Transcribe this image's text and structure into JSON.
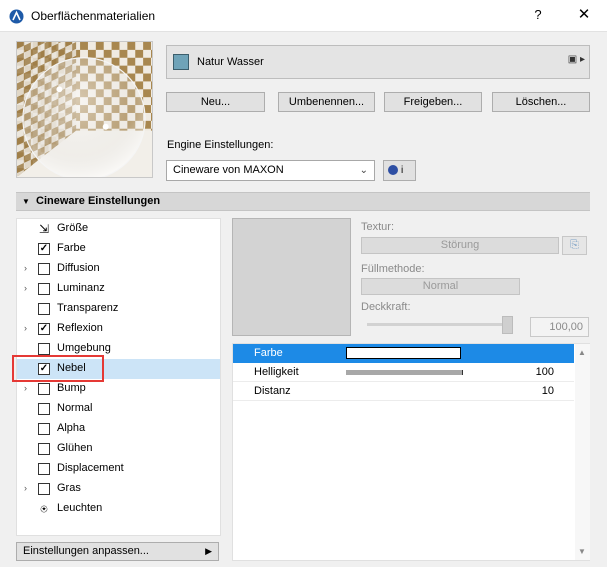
{
  "window": {
    "title": "Oberflächenmaterialien",
    "help": "?",
    "close": "✕"
  },
  "material": {
    "name": "Natur Wasser",
    "swatch_color": "#6fa3b8",
    "icons": "▣ ▸"
  },
  "buttons": {
    "new": "Neu...",
    "rename": "Umbenennen...",
    "share": "Freigeben...",
    "delete": "Löschen..."
  },
  "engine": {
    "label": "Engine Einstellungen:",
    "selected": "Cineware von MAXON",
    "caret": "⌄",
    "info": "i"
  },
  "section": {
    "title": "Cineware Einstellungen",
    "toggle": "▼"
  },
  "channels": [
    {
      "label": "Größe",
      "check": "⇲",
      "arrow": ""
    },
    {
      "label": "Farbe",
      "check": "✓",
      "arrow": ""
    },
    {
      "label": "Diffusion",
      "check": "",
      "arrow": "›"
    },
    {
      "label": "Luminanz",
      "check": "",
      "arrow": "›"
    },
    {
      "label": "Transparenz",
      "check": "",
      "arrow": ""
    },
    {
      "label": "Reflexion",
      "check": "✓",
      "arrow": "›"
    },
    {
      "label": "Umgebung",
      "check": "",
      "arrow": ""
    },
    {
      "label": "Nebel",
      "check": "✓",
      "arrow": ""
    },
    {
      "label": "Bump",
      "check": "",
      "arrow": "›"
    },
    {
      "label": "Normal",
      "check": "",
      "arrow": ""
    },
    {
      "label": "Alpha",
      "check": "",
      "arrow": ""
    },
    {
      "label": "Glühen",
      "check": "",
      "arrow": ""
    },
    {
      "label": "Displacement",
      "check": "",
      "arrow": ""
    },
    {
      "label": "Gras",
      "check": "",
      "arrow": "›"
    },
    {
      "label": "Leuchten",
      "check": "⍟",
      "arrow": ""
    }
  ],
  "customize": {
    "label": "Einstellungen anpassen...",
    "arrow": "▶"
  },
  "texture": {
    "label": "Textur:",
    "value": "Störung",
    "icon": "⎘"
  },
  "fill": {
    "label": "Füllmethode:",
    "value": "Normal"
  },
  "opacity": {
    "label": "Deckkraft:",
    "value": "100,00",
    "level_percent": 100
  },
  "params": [
    {
      "name": "Farbe",
      "value": "",
      "kind": "color"
    },
    {
      "name": "Helligkeit",
      "value": "100",
      "kind": "slider",
      "level_percent": 100
    },
    {
      "name": "Distanz",
      "value": "10",
      "kind": "number"
    }
  ],
  "scroll": {
    "up": "▲",
    "down": "▼"
  },
  "colors": {
    "selection": "#1d8ae6",
    "list_selection": "#cce4f7",
    "highlight": "#e53935"
  }
}
